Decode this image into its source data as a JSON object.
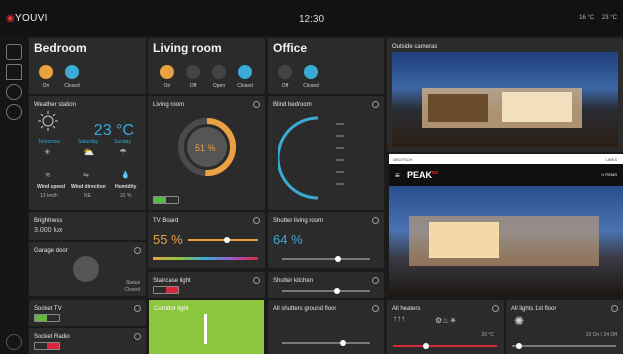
{
  "topbar": {
    "logo": "YOUVI",
    "time": "12:30",
    "temp_outside": "16 °C",
    "temp_inside": "23 °C"
  },
  "rooms": {
    "bedroom": {
      "title": "Bedroom",
      "buttons": [
        "On",
        "Closed"
      ]
    },
    "living": {
      "title": "Living room",
      "buttons": [
        "On",
        "Off",
        "Open",
        "Closed"
      ]
    },
    "office": {
      "title": "Office",
      "buttons": [
        "Off",
        "Closed"
      ]
    }
  },
  "weather": {
    "title": "Weather station",
    "current_temp": "23 °C",
    "days": [
      "Tomorrow",
      "Saturday",
      "Sunday"
    ],
    "metrics": [
      {
        "label": "Wind speed",
        "value": "13 km/h"
      },
      {
        "label": "Wind direction",
        "value": "NE"
      },
      {
        "label": "Humidity",
        "value": "32 %"
      }
    ]
  },
  "brightness": {
    "title": "Brightness",
    "value": "3.000 lux"
  },
  "garage": {
    "title": "Garage door",
    "status_label": "Status",
    "status_value": "Closed"
  },
  "socket_tv": {
    "title": "Socket TV"
  },
  "socket_radio": {
    "title": "Socket Radio"
  },
  "living_light": {
    "title": "Living room",
    "value": "51 %",
    "value_fraction": 0.51
  },
  "blind_bedroom": {
    "title": "Blind bedroom"
  },
  "tv_board": {
    "title": "TV Board",
    "value": "55 %",
    "value_fraction": 0.55
  },
  "staircase": {
    "title": "Staircase light"
  },
  "corridor": {
    "title": "Corridor light"
  },
  "shutter_living": {
    "title": "Shutter living room",
    "value": "64 %",
    "value_fraction": 0.64
  },
  "shutter_kitchen": {
    "title": "Shutter kitchen"
  },
  "all_shutters": {
    "title": "All shutters ground floor"
  },
  "cameras": {
    "title": "Outside cameras"
  },
  "peak": {
    "lang": "DEUTSCH",
    "links": "LINKS",
    "logo": "PEAK",
    "logo_sup": "nx",
    "cart": "0 ITEMS"
  },
  "heaters": {
    "title": "All heaters",
    "temp": "20 °C"
  },
  "lights_1st": {
    "title": "All lights 1st floor",
    "summary": "10 On / 24 Off"
  },
  "colors": {
    "accent_blue": "#3ba9d6",
    "accent_orange": "#e9a141",
    "green": "#63b442",
    "red": "#d7263d"
  }
}
